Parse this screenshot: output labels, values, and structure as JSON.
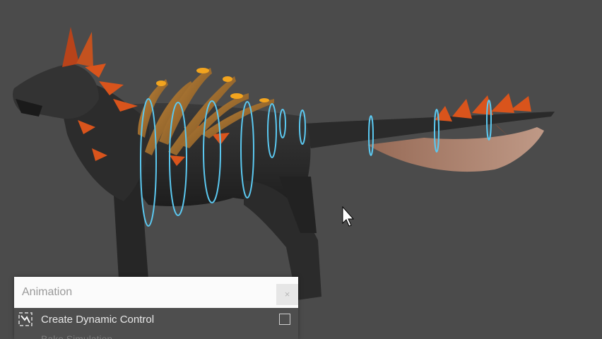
{
  "viewport": {
    "background": "#4b4b4b",
    "subject": "wolf-model",
    "control_ring_color": "#5bc8f0",
    "fur_accent_color": "#d9541c"
  },
  "panel": {
    "title": "Animation",
    "close_label": "×",
    "items": [
      {
        "label": "Create Dynamic Control",
        "icon": "dynamic-control-icon",
        "checked": false
      },
      {
        "label": "Bake Simulation"
      }
    ]
  }
}
